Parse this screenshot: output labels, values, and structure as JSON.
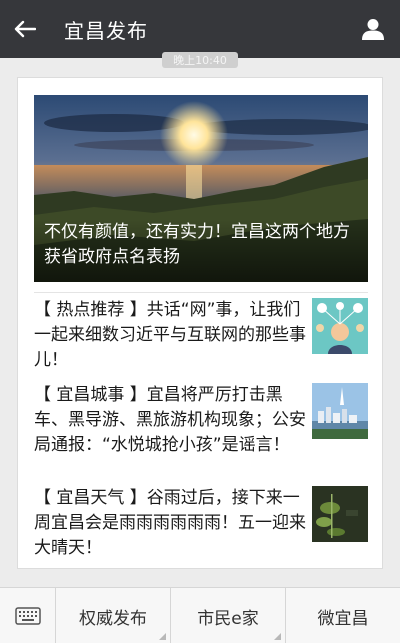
{
  "header": {
    "title": "宜昌发布",
    "time": "晚上10:40"
  },
  "hero": {
    "caption": "不仅有颜值，还有实力！宜昌这两个地方获省政府点名表扬"
  },
  "articles": [
    {
      "text": "【 热点推荐 】共话“网”事，让我们一起来细数习近平与互联网的那些事儿！",
      "thumb": "network-illustration"
    },
    {
      "text": "【 宜昌城事 】宜昌将严厉打击黑车、黑导游、黑旅游机构现象；公安局通报：“水悦城抢小孩”是谣言！",
      "thumb": "city-skyline"
    },
    {
      "text": "【 宜昌天气 】谷雨过后，接下来一周宜昌会是雨雨雨雨雨雨！五一迎来大晴天！",
      "thumb": "rain-plant"
    }
  ],
  "menu": {
    "items": [
      "权威发布",
      "市民e家",
      "微宜昌"
    ]
  },
  "icons": {
    "back": "back-arrow-icon",
    "profile": "person-icon",
    "keyboard": "keyboard-icon"
  },
  "colors": {
    "topbar": "#36373b",
    "background": "#ececec",
    "card": "#ffffff"
  }
}
